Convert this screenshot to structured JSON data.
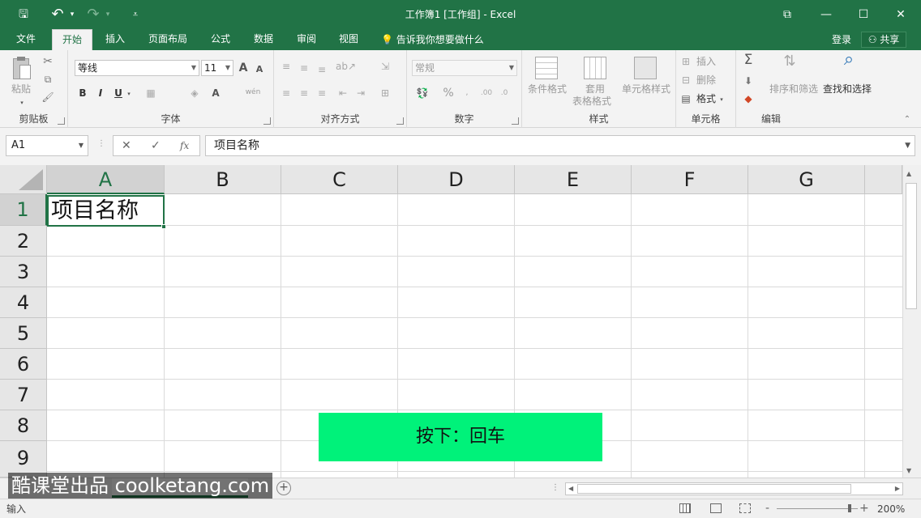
{
  "window": {
    "title": "工作簿1 [工作组] - Excel",
    "controls": {
      "ribbon_display": "⧉",
      "minimize": "—",
      "maximize": "☐",
      "close": "✕"
    }
  },
  "quick_access": {
    "save": "🖫",
    "undo": "↶",
    "undo_dd": "▾",
    "redo": "↷",
    "redo_dd": "▾",
    "customize": "⩡"
  },
  "tabs": [
    "文件",
    "开始",
    "插入",
    "页面布局",
    "公式",
    "数据",
    "审阅",
    "视图"
  ],
  "active_tab": "开始",
  "tell_me": "告诉我你想要做什么",
  "account": {
    "signin": "登录",
    "share": "共享"
  },
  "ribbon": {
    "clipboard": {
      "label": "剪贴板",
      "paste": "粘贴"
    },
    "font": {
      "label": "字体",
      "name": "等线",
      "size": "11",
      "bold": "B",
      "italic": "I",
      "underline": "U",
      "grow": "A",
      "shrink": "A",
      "color": "A",
      "phonetic": "wén"
    },
    "alignment": {
      "label": "对齐方式"
    },
    "number": {
      "label": "数字",
      "format": "常规",
      "percent": "%"
    },
    "styles": {
      "label": "样式",
      "conditional": "条件格式",
      "table1": "套用",
      "table2": "表格格式",
      "cell_styles": "单元格样式"
    },
    "cells": {
      "label": "单元格",
      "insert": "插入",
      "delete": "删除",
      "format": "格式"
    },
    "editing": {
      "label": "编辑",
      "sigma": "Σ",
      "sort_filter": "排序和筛选",
      "find_select": "查找和选择"
    }
  },
  "formula_bar": {
    "name_box": "A1",
    "cancel": "✕",
    "enter": "✓",
    "fx": "fx",
    "content": "项目名称"
  },
  "columns": [
    "A",
    "B",
    "C",
    "D",
    "E",
    "F",
    "G"
  ],
  "selected_column": "A",
  "rows": [
    "1",
    "2",
    "3",
    "4",
    "5",
    "6",
    "7",
    "8",
    "9"
  ],
  "selected_row": "1",
  "cells": {
    "A1": "项目名称"
  },
  "overlay": {
    "keypress": "按下：回车"
  },
  "sheets": {
    "add": "+"
  },
  "watermark": "酷课堂出品 coolketang.com",
  "status": {
    "mode": "输入",
    "zoom": "200%",
    "zoom_minus": "-",
    "zoom_plus": "+"
  },
  "colors": {
    "accent": "#217346",
    "toast": "#00f27a"
  }
}
